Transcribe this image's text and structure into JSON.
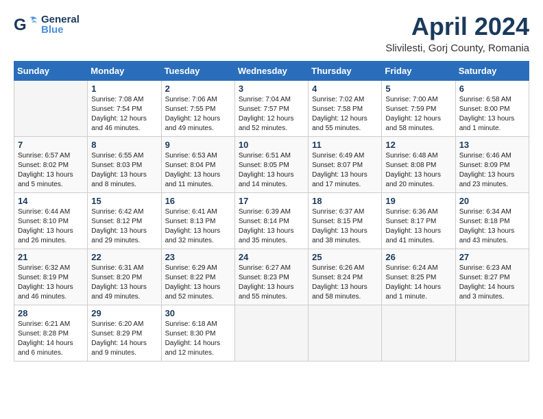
{
  "header": {
    "logo_general": "General",
    "logo_blue": "Blue",
    "title": "April 2024",
    "subtitle": "Slivilesti, Gorj County, Romania"
  },
  "columns": [
    "Sunday",
    "Monday",
    "Tuesday",
    "Wednesday",
    "Thursday",
    "Friday",
    "Saturday"
  ],
  "weeks": [
    [
      {
        "day": "",
        "info": ""
      },
      {
        "day": "1",
        "info": "Sunrise: 7:08 AM\nSunset: 7:54 PM\nDaylight: 12 hours\nand 46 minutes."
      },
      {
        "day": "2",
        "info": "Sunrise: 7:06 AM\nSunset: 7:55 PM\nDaylight: 12 hours\nand 49 minutes."
      },
      {
        "day": "3",
        "info": "Sunrise: 7:04 AM\nSunset: 7:57 PM\nDaylight: 12 hours\nand 52 minutes."
      },
      {
        "day": "4",
        "info": "Sunrise: 7:02 AM\nSunset: 7:58 PM\nDaylight: 12 hours\nand 55 minutes."
      },
      {
        "day": "5",
        "info": "Sunrise: 7:00 AM\nSunset: 7:59 PM\nDaylight: 12 hours\nand 58 minutes."
      },
      {
        "day": "6",
        "info": "Sunrise: 6:58 AM\nSunset: 8:00 PM\nDaylight: 13 hours\nand 1 minute."
      }
    ],
    [
      {
        "day": "7",
        "info": "Sunrise: 6:57 AM\nSunset: 8:02 PM\nDaylight: 13 hours\nand 5 minutes."
      },
      {
        "day": "8",
        "info": "Sunrise: 6:55 AM\nSunset: 8:03 PM\nDaylight: 13 hours\nand 8 minutes."
      },
      {
        "day": "9",
        "info": "Sunrise: 6:53 AM\nSunset: 8:04 PM\nDaylight: 13 hours\nand 11 minutes."
      },
      {
        "day": "10",
        "info": "Sunrise: 6:51 AM\nSunset: 8:05 PM\nDaylight: 13 hours\nand 14 minutes."
      },
      {
        "day": "11",
        "info": "Sunrise: 6:49 AM\nSunset: 8:07 PM\nDaylight: 13 hours\nand 17 minutes."
      },
      {
        "day": "12",
        "info": "Sunrise: 6:48 AM\nSunset: 8:08 PM\nDaylight: 13 hours\nand 20 minutes."
      },
      {
        "day": "13",
        "info": "Sunrise: 6:46 AM\nSunset: 8:09 PM\nDaylight: 13 hours\nand 23 minutes."
      }
    ],
    [
      {
        "day": "14",
        "info": "Sunrise: 6:44 AM\nSunset: 8:10 PM\nDaylight: 13 hours\nand 26 minutes."
      },
      {
        "day": "15",
        "info": "Sunrise: 6:42 AM\nSunset: 8:12 PM\nDaylight: 13 hours\nand 29 minutes."
      },
      {
        "day": "16",
        "info": "Sunrise: 6:41 AM\nSunset: 8:13 PM\nDaylight: 13 hours\nand 32 minutes."
      },
      {
        "day": "17",
        "info": "Sunrise: 6:39 AM\nSunset: 8:14 PM\nDaylight: 13 hours\nand 35 minutes."
      },
      {
        "day": "18",
        "info": "Sunrise: 6:37 AM\nSunset: 8:15 PM\nDaylight: 13 hours\nand 38 minutes."
      },
      {
        "day": "19",
        "info": "Sunrise: 6:36 AM\nSunset: 8:17 PM\nDaylight: 13 hours\nand 41 minutes."
      },
      {
        "day": "20",
        "info": "Sunrise: 6:34 AM\nSunset: 8:18 PM\nDaylight: 13 hours\nand 43 minutes."
      }
    ],
    [
      {
        "day": "21",
        "info": "Sunrise: 6:32 AM\nSunset: 8:19 PM\nDaylight: 13 hours\nand 46 minutes."
      },
      {
        "day": "22",
        "info": "Sunrise: 6:31 AM\nSunset: 8:20 PM\nDaylight: 13 hours\nand 49 minutes."
      },
      {
        "day": "23",
        "info": "Sunrise: 6:29 AM\nSunset: 8:22 PM\nDaylight: 13 hours\nand 52 minutes."
      },
      {
        "day": "24",
        "info": "Sunrise: 6:27 AM\nSunset: 8:23 PM\nDaylight: 13 hours\nand 55 minutes."
      },
      {
        "day": "25",
        "info": "Sunrise: 6:26 AM\nSunset: 8:24 PM\nDaylight: 13 hours\nand 58 minutes."
      },
      {
        "day": "26",
        "info": "Sunrise: 6:24 AM\nSunset: 8:25 PM\nDaylight: 14 hours\nand 1 minute."
      },
      {
        "day": "27",
        "info": "Sunrise: 6:23 AM\nSunset: 8:27 PM\nDaylight: 14 hours\nand 3 minutes."
      }
    ],
    [
      {
        "day": "28",
        "info": "Sunrise: 6:21 AM\nSunset: 8:28 PM\nDaylight: 14 hours\nand 6 minutes."
      },
      {
        "day": "29",
        "info": "Sunrise: 6:20 AM\nSunset: 8:29 PM\nDaylight: 14 hours\nand 9 minutes."
      },
      {
        "day": "30",
        "info": "Sunrise: 6:18 AM\nSunset: 8:30 PM\nDaylight: 14 hours\nand 12 minutes."
      },
      {
        "day": "",
        "info": ""
      },
      {
        "day": "",
        "info": ""
      },
      {
        "day": "",
        "info": ""
      },
      {
        "day": "",
        "info": ""
      }
    ]
  ]
}
